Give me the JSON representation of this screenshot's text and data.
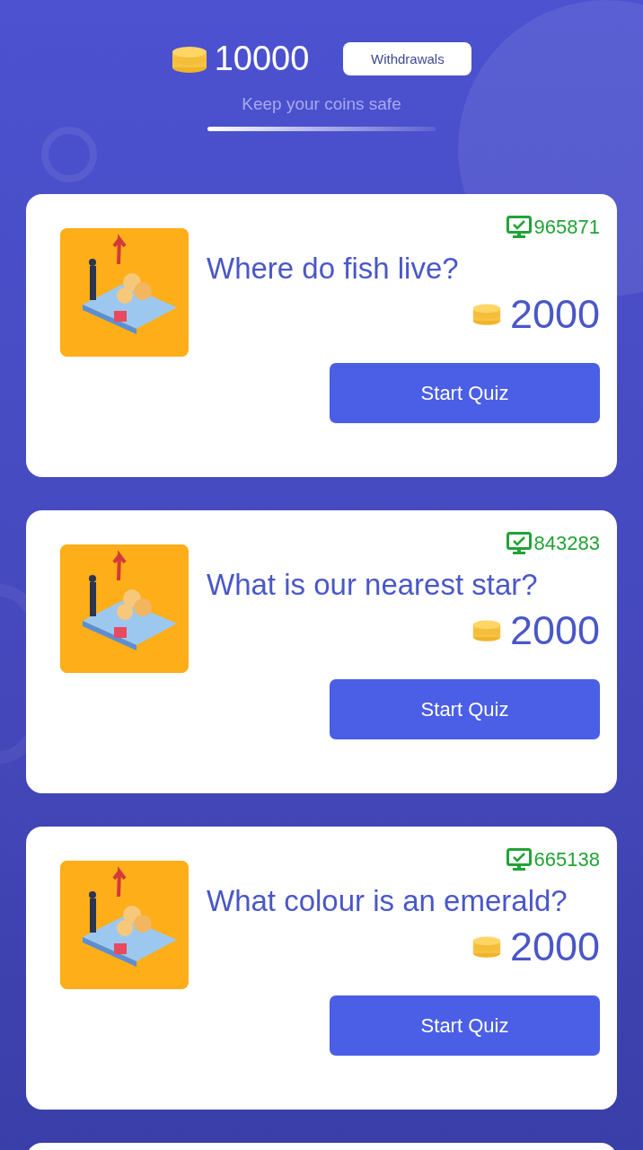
{
  "balance": {
    "amount": "10000",
    "button": "Withdrawals",
    "subtitle": "Keep your coins safe"
  },
  "quizzes": [
    {
      "views": "965871",
      "question": "Where do fish live?",
      "reward": "2000",
      "button": "Start Quiz"
    },
    {
      "views": "843283",
      "question": "What is our nearest star?",
      "reward": "2000",
      "button": "Start Quiz"
    },
    {
      "views": "665138",
      "question": "What colour is an emerald?",
      "reward": "2000",
      "button": "Start Quiz"
    }
  ],
  "more_below": true
}
